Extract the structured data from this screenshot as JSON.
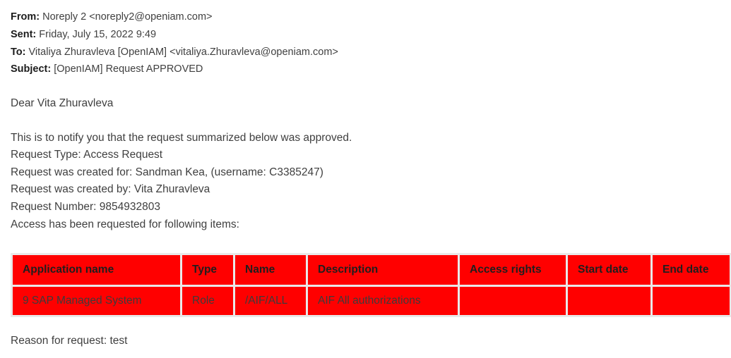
{
  "email": {
    "headers": [
      {
        "label": "From:",
        "value": "Noreply 2 <noreply2@openiam.com>"
      },
      {
        "label": "Sent:",
        "value": "Friday, July 15, 2022 9:49"
      },
      {
        "label": "To:",
        "value": "Vitaliya Zhuravleva [OpenIAM] <vitaliya.Zhuravleva@openiam.com>"
      },
      {
        "label": "Subject:",
        "value": "[OpenIAM] Request APPROVED"
      }
    ],
    "greeting": "Dear Vita Zhuravleva",
    "body_lines": [
      "This is to notify you that the request summarized below was approved.",
      "Request Type: Access Request",
      "Request was created for: Sandman Kea, (username: C3385247)",
      "Request was created by: Vita Zhuravleva",
      "Request Number: 9854932803",
      "Access has been requested for following items:"
    ],
    "footer_lines": [
      "Reason for request: test"
    ]
  },
  "table": {
    "columns": [
      "Application name",
      "Type",
      "Name",
      "Description",
      "Access rights",
      "Start date",
      "End date"
    ],
    "rows": [
      {
        "application_name": "9 SAP Managed System",
        "type": "Role",
        "name": "/AIF/ALL",
        "description": "AIF All authorizations",
        "access_rights": "",
        "start_date": "",
        "end_date": ""
      }
    ]
  },
  "colors": {
    "table_cell_background": "#FF0000",
    "table_border": "#E9E9E9",
    "header_text": "#1F1F1F",
    "body_text": "#3F3F3F"
  }
}
